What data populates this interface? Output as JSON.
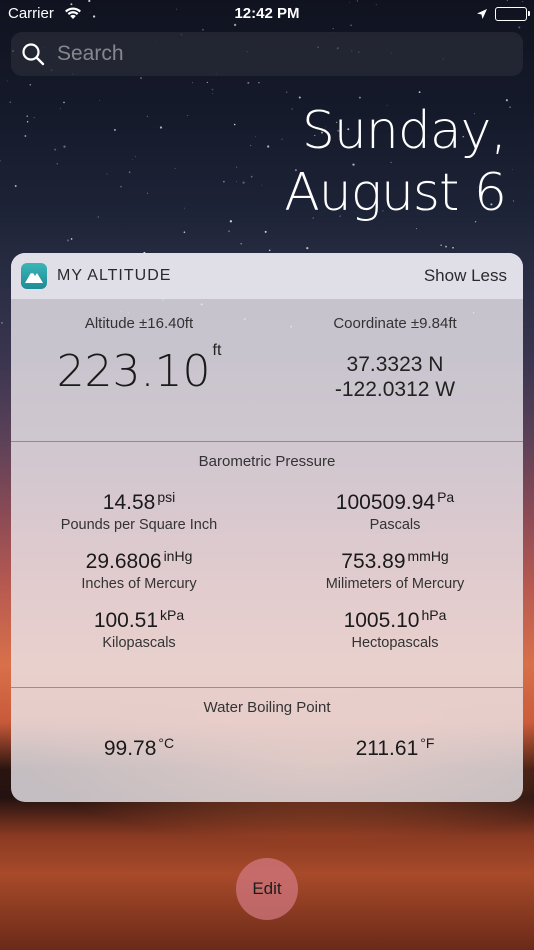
{
  "status_bar": {
    "carrier": "Carrier",
    "time": "12:42 PM"
  },
  "search": {
    "placeholder": "Search"
  },
  "date": {
    "line1": "Sunday,",
    "line2": "August 6"
  },
  "widget": {
    "app_name": "MY ALTITUDE",
    "toggle_label": "Show Less",
    "altitude": {
      "label": "Altitude ±16.40ft",
      "value": "223.10",
      "unit": "ft"
    },
    "coordinate": {
      "label": "Coordinate ±9.84ft",
      "lat": "37.3323 N",
      "lon": "-122.0312 W"
    },
    "pressure": {
      "title": "Barometric Pressure",
      "items": [
        {
          "value": "14.58",
          "unit": "psi",
          "name": "Pounds per Square Inch"
        },
        {
          "value": "100509.94",
          "unit": "Pa",
          "name": "Pascals"
        },
        {
          "value": "29.6806",
          "unit": "inHg",
          "name": "Inches of Mercury"
        },
        {
          "value": "753.89",
          "unit": "mmHg",
          "name": "Milimeters of Mercury"
        },
        {
          "value": "100.51",
          "unit": "kPa",
          "name": "Kilopascals"
        },
        {
          "value": "1005.10",
          "unit": "hPa",
          "name": "Hectopascals"
        }
      ]
    },
    "boiling": {
      "title": "Water Boiling Point",
      "celsius": {
        "value": "99.78",
        "unit": "°C"
      },
      "fahrenheit": {
        "value": "211.61",
        "unit": "°F"
      }
    }
  },
  "edit_label": "Edit",
  "colors": {
    "widget_bg": "#ece8ee",
    "app_icon": "#2a9ea6",
    "edit_button": "#d27882"
  }
}
